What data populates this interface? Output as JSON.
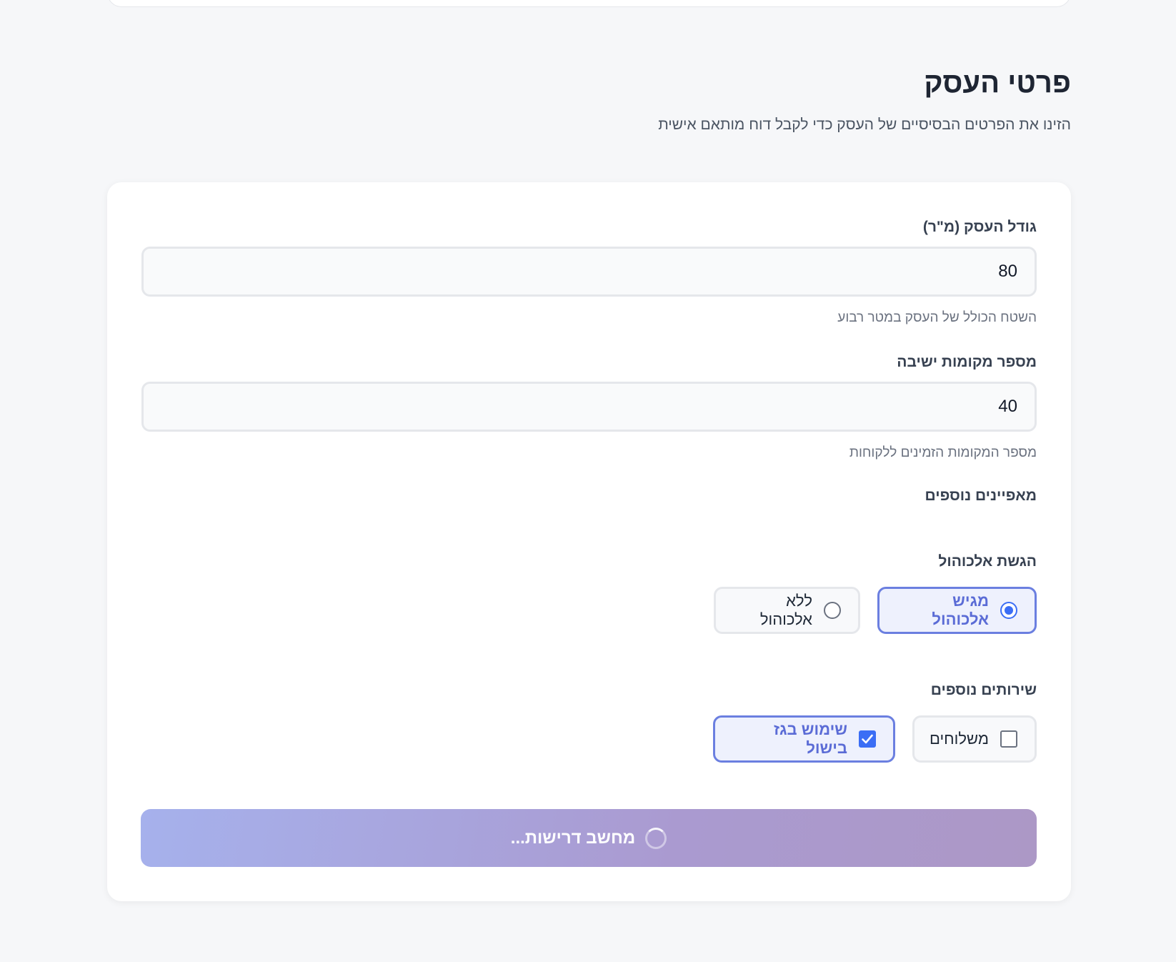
{
  "page": {
    "title": "פרטי העסק",
    "subtitle": "הזינו את הפרטים הבסיסיים של העסק כדי לקבל דוח מותאם אישית"
  },
  "form": {
    "business_size": {
      "label": "גודל העסק (מ\"ר)",
      "value": "80",
      "help": "השטח הכולל של העסק במטר רבוע"
    },
    "seats": {
      "label": "מספר מקומות ישיבה",
      "value": "40",
      "help": "מספר המקומות הזמינים ללקוחות"
    },
    "extra_features_label": "מאפיינים נוספים",
    "alcohol": {
      "label": "הגשת אלכוהול",
      "options": [
        {
          "label": "מגיש אלכוהול",
          "selected": true
        },
        {
          "label": "ללא אלכוהול",
          "selected": false
        }
      ]
    },
    "services": {
      "label": "שירותים נוספים",
      "options": [
        {
          "label": "משלוחים",
          "checked": false
        },
        {
          "label": "שימוש בגז בישול",
          "checked": true
        }
      ]
    },
    "submit": {
      "label": "מחשב דרישות...",
      "state": "loading"
    }
  },
  "colors": {
    "accent": "#3b6ef5",
    "selected_border": "#6b7fe0",
    "button_gradient_start": "#a6b1ec",
    "button_gradient_end": "#ac98c6"
  }
}
